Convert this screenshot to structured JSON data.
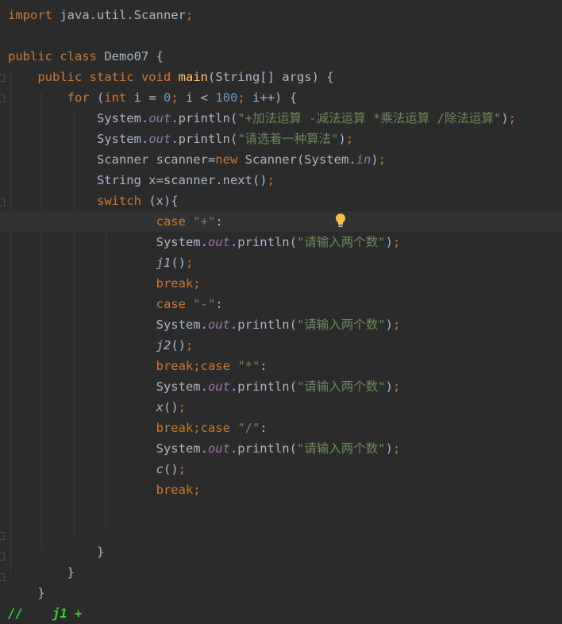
{
  "editor": {
    "theme": "darcula",
    "background": "#2b2b2b",
    "caret_line_background": "#323232",
    "colors": {
      "keyword": "#cc7832",
      "string": "#6a8759",
      "number": "#6897bb",
      "field": "#9876aa",
      "method_declaration": "#ffc66d",
      "plain": "#a9b7c6",
      "comment": "#2bd72b"
    },
    "intention_icon": "lightbulb-icon",
    "lines": [
      {
        "tokens": [
          [
            "kw",
            "import"
          ],
          [
            "p",
            " java.util.Scanner"
          ],
          [
            "kw",
            ";"
          ]
        ]
      },
      {
        "tokens": []
      },
      {
        "tokens": [
          [
            "kw",
            "public class"
          ],
          [
            "p",
            " Demo07 {"
          ]
        ]
      },
      {
        "tokens": [
          [
            "p",
            "    "
          ],
          [
            "kw",
            "public static void"
          ],
          [
            "p",
            " "
          ],
          [
            "fn",
            "main"
          ],
          [
            "p",
            "(String[] args) {"
          ]
        ]
      },
      {
        "tokens": [
          [
            "p",
            "        "
          ],
          [
            "kw",
            "for"
          ],
          [
            "p",
            " ("
          ],
          [
            "kw",
            "int"
          ],
          [
            "p",
            " i = "
          ],
          [
            "num",
            "0"
          ],
          [
            "kw",
            ";"
          ],
          [
            "p",
            " i < "
          ],
          [
            "num",
            "100"
          ],
          [
            "kw",
            ";"
          ],
          [
            "p",
            " i++) {"
          ]
        ]
      },
      {
        "tokens": [
          [
            "p",
            "            System."
          ],
          [
            "fld",
            "out"
          ],
          [
            "p",
            ".println("
          ],
          [
            "str",
            "\"+加法运算 -减法运算 *乘法运算 /除法运算\""
          ],
          [
            "p",
            ")"
          ],
          [
            "kw",
            ";"
          ]
        ]
      },
      {
        "tokens": [
          [
            "p",
            "            System."
          ],
          [
            "fld",
            "out"
          ],
          [
            "p",
            ".println("
          ],
          [
            "str",
            "\"请选着一种算法\""
          ],
          [
            "p",
            ")"
          ],
          [
            "kw",
            ";"
          ]
        ]
      },
      {
        "tokens": [
          [
            "p",
            "            Scanner scanner="
          ],
          [
            "kw",
            "new"
          ],
          [
            "p",
            " Scanner(System."
          ],
          [
            "fld",
            "in"
          ],
          [
            "p",
            ")"
          ],
          [
            "kw",
            ";"
          ]
        ]
      },
      {
        "tokens": [
          [
            "p",
            "            String x=scanner.next()"
          ],
          [
            "kw",
            ";"
          ]
        ]
      },
      {
        "tokens": [
          [
            "p",
            "            "
          ],
          [
            "kw",
            "switch"
          ],
          [
            "p",
            " (x){"
          ]
        ]
      },
      {
        "tokens": [
          [
            "p",
            "                    "
          ],
          [
            "kw",
            "case"
          ],
          [
            "p",
            " "
          ],
          [
            "str",
            "\"+\""
          ],
          [
            "p",
            ":"
          ]
        ],
        "caret": true
      },
      {
        "tokens": [
          [
            "p",
            "                    System."
          ],
          [
            "fld",
            "out"
          ],
          [
            "p",
            ".println("
          ],
          [
            "str",
            "\"请输入两个数\""
          ],
          [
            "p",
            ")"
          ],
          [
            "kw",
            ";"
          ]
        ]
      },
      {
        "tokens": [
          [
            "p",
            "                    "
          ],
          [
            "call",
            "j1"
          ],
          [
            "p",
            "()"
          ],
          [
            "kw",
            ";"
          ]
        ]
      },
      {
        "tokens": [
          [
            "p",
            "                    "
          ],
          [
            "kw",
            "break;"
          ]
        ]
      },
      {
        "tokens": [
          [
            "p",
            "                    "
          ],
          [
            "kw",
            "case"
          ],
          [
            "p",
            " "
          ],
          [
            "str",
            "\"-\""
          ],
          [
            "p",
            ":"
          ]
        ]
      },
      {
        "tokens": [
          [
            "p",
            "                    System."
          ],
          [
            "fld",
            "out"
          ],
          [
            "p",
            ".println("
          ],
          [
            "str",
            "\"请输入两个数\""
          ],
          [
            "p",
            ")"
          ],
          [
            "kw",
            ";"
          ]
        ]
      },
      {
        "tokens": [
          [
            "p",
            "                    "
          ],
          [
            "call",
            "j2"
          ],
          [
            "p",
            "()"
          ],
          [
            "kw",
            ";"
          ]
        ]
      },
      {
        "tokens": [
          [
            "p",
            "                    "
          ],
          [
            "kw",
            "break;case"
          ],
          [
            "p",
            " "
          ],
          [
            "str",
            "\"*\""
          ],
          [
            "p",
            ":"
          ]
        ]
      },
      {
        "tokens": [
          [
            "p",
            "                    System."
          ],
          [
            "fld",
            "out"
          ],
          [
            "p",
            ".println("
          ],
          [
            "str",
            "\"请输入两个数\""
          ],
          [
            "p",
            ")"
          ],
          [
            "kw",
            ";"
          ]
        ]
      },
      {
        "tokens": [
          [
            "p",
            "                    "
          ],
          [
            "call",
            "x"
          ],
          [
            "p",
            "()"
          ],
          [
            "kw",
            ";"
          ]
        ]
      },
      {
        "tokens": [
          [
            "p",
            "                    "
          ],
          [
            "kw",
            "break;case"
          ],
          [
            "p",
            " "
          ],
          [
            "str",
            "\"/\""
          ],
          [
            "p",
            ":"
          ]
        ]
      },
      {
        "tokens": [
          [
            "p",
            "                    System."
          ],
          [
            "fld",
            "out"
          ],
          [
            "p",
            ".println("
          ],
          [
            "str",
            "\"请输入两个数\""
          ],
          [
            "p",
            ")"
          ],
          [
            "kw",
            ";"
          ]
        ]
      },
      {
        "tokens": [
          [
            "p",
            "                    "
          ],
          [
            "call",
            "c"
          ],
          [
            "p",
            "()"
          ],
          [
            "kw",
            ";"
          ]
        ]
      },
      {
        "tokens": [
          [
            "p",
            "                    "
          ],
          [
            "kw",
            "break;"
          ]
        ]
      },
      {
        "tokens": []
      },
      {
        "tokens": []
      },
      {
        "tokens": [
          [
            "p",
            "            }"
          ]
        ]
      },
      {
        "tokens": [
          [
            "p",
            "        }"
          ]
        ]
      },
      {
        "tokens": [
          [
            "p",
            "    }"
          ]
        ]
      },
      {
        "tokens": [
          [
            "cmt",
            "//    j1 +"
          ]
        ]
      }
    ]
  }
}
